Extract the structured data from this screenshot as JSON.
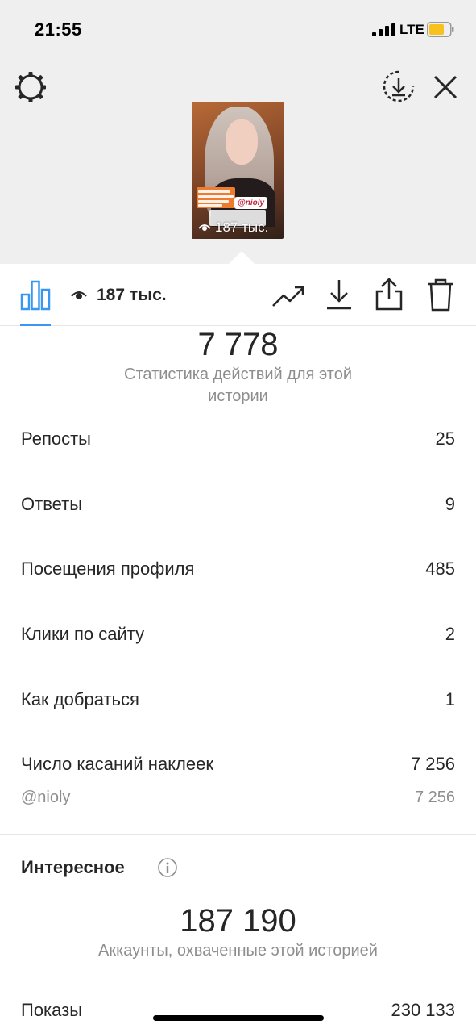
{
  "status_bar": {
    "time": "21:55",
    "network": "LTE",
    "battery_color": "#f7c21d"
  },
  "header": {
    "settings_icon": "gear-icon",
    "download_icon": "download-circle-icon",
    "close_icon": "close-icon"
  },
  "story_preview": {
    "mention": "@nioly",
    "views_overlay": "187 тыс."
  },
  "toolbar": {
    "views": "187 тыс.",
    "active_tab": "insights",
    "accent_color": "#3897f0",
    "icons": [
      "bar-chart-icon",
      "eye-icon",
      "trend-icon",
      "download-icon",
      "share-icon",
      "trash-icon"
    ]
  },
  "interactions": {
    "total": "7 778",
    "caption": "Статистика действий для этой истории",
    "rows": [
      {
        "label": "Репосты",
        "value": "25"
      },
      {
        "label": "Ответы",
        "value": "9"
      },
      {
        "label": "Посещения профиля",
        "value": "485"
      },
      {
        "label": "Клики по сайту",
        "value": "2"
      },
      {
        "label": "Как добраться",
        "value": "1"
      },
      {
        "label": "Число касаний наклеек",
        "value": "7 256"
      }
    ],
    "sticker_sub": {
      "label": "@nioly",
      "value": "7 256"
    }
  },
  "discovery": {
    "title": "Интересное",
    "reach": "187 190",
    "caption": "Аккаунты, охваченные этой историей",
    "impressions_label": "Показы",
    "impressions_value": "230 133"
  }
}
